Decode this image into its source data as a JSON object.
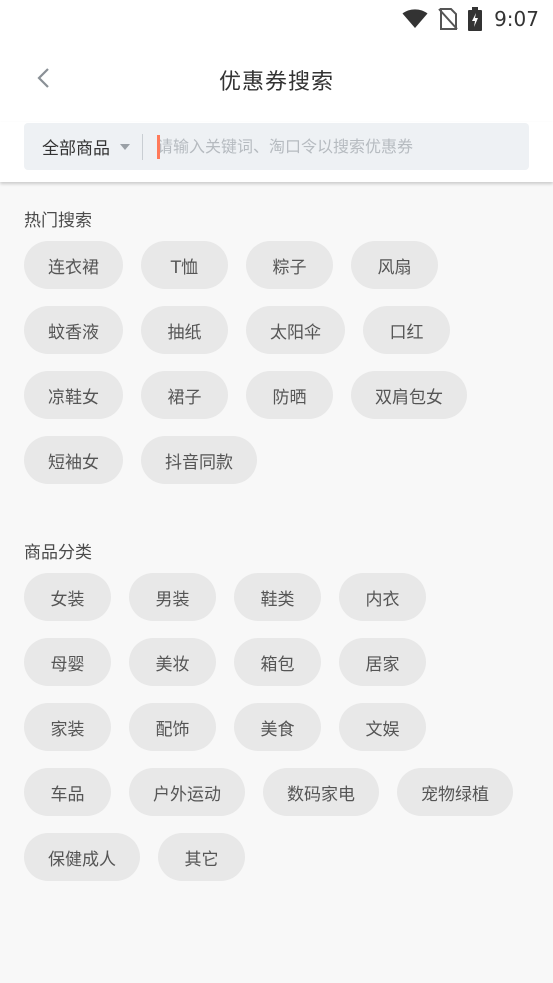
{
  "status_bar": {
    "time": "9:07",
    "icons": [
      "wifi-icon",
      "no-sim-icon",
      "battery-charging-icon"
    ]
  },
  "header": {
    "title": "优惠券搜索",
    "back_icon": "chevron-left-icon"
  },
  "search": {
    "category": "全部商品",
    "placeholder": "请输入关键词、淘口令以搜索优惠券",
    "value": ""
  },
  "hot_search": {
    "title": "热门搜索",
    "tags": [
      "连衣裙",
      "T恤",
      "粽子",
      "风扇",
      "蚊香液",
      "抽纸",
      "太阳伞",
      "口红",
      "凉鞋女",
      "裙子",
      "防晒",
      "双肩包女",
      "短袖女",
      "抖音同款"
    ]
  },
  "categories": {
    "title": "商品分类",
    "tags": [
      "女装",
      "男装",
      "鞋类",
      "内衣",
      "母婴",
      "美妆",
      "箱包",
      "居家",
      "家装",
      "配饰",
      "美食",
      "文娱",
      "车品",
      "户外运动",
      "数码家电",
      "宠物绿植",
      "保健成人",
      "其它"
    ]
  },
  "colors": {
    "background": "#f8f8f8",
    "tag_bg": "#e8e8e8",
    "search_bg": "#eef1f4",
    "cursor": "#ff7a5a"
  }
}
